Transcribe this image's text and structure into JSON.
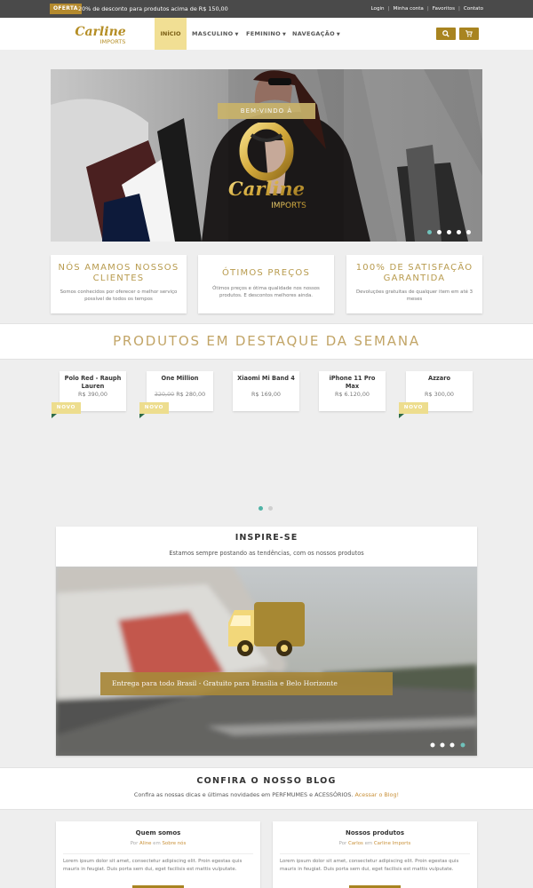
{
  "topbar": {
    "badge": "OFERTA",
    "promo": "20% de desconto para produtos acima de R$ 150,00",
    "links": [
      "Login",
      "Minha conta",
      "Favoritos",
      "Contato"
    ]
  },
  "brand": {
    "name": "Carline",
    "sub": "IMPORTS"
  },
  "nav": {
    "items": [
      "INÍCIO",
      "MASCULINO",
      "FEMININO",
      "NAVEGAÇÃO"
    ],
    "search_icon": "search-icon",
    "cart_icon": "cart-icon"
  },
  "hero": {
    "welcome": "BEM-VINDO À",
    "dots": 5,
    "active_dot": 0
  },
  "features": [
    {
      "title": "NÓS AMAMOS NOSSOS CLIENTES",
      "text": "Somos conhecidos por oferecer o melhor serviço possível de todos os tempos"
    },
    {
      "title": "ÓTIMOS PREÇOS",
      "text": "Ótimos preços e ótima qualidade nos nossos produtos. E descontos melhores ainda."
    },
    {
      "title": "100% DE SATISFAÇÃO GARANTIDA",
      "text": "Devoluções gratuitas de qualquer item em até 3 meses"
    }
  ],
  "products_section": {
    "title": "PRODUTOS EM DESTAQUE DA SEMANA"
  },
  "products": [
    {
      "name": "Polo Red - Rauph Lauren",
      "old_price": "",
      "price": "R$ 390,00",
      "badge": "NOVO"
    },
    {
      "name": "One Million",
      "old_price": "320,00",
      "price": "R$ 280,00",
      "badge": "NOVO"
    },
    {
      "name": "Xiaomi Mi Band 4",
      "old_price": "",
      "price": "R$ 169,00",
      "badge": ""
    },
    {
      "name": "iPhone 11 Pro Max",
      "old_price": "",
      "price": "R$ 6.120,00",
      "badge": ""
    },
    {
      "name": "Azzaro",
      "old_price": "",
      "price": "R$ 300,00",
      "badge": "NOVO"
    }
  ],
  "inspire": {
    "title": "INSPIRE-SE",
    "subtitle": "Estamos sempre postando as tendências, com os nossos produtos",
    "caption": "Entrega para todo Brasil - Gratuito para Brasília e Belo Horizonte"
  },
  "blog": {
    "title": "CONFIRA O NOSSO BLOG",
    "subtitle": "Confira as nossas dicas e últimas novidades em PERFMUMES e ACESSÓRIOS.",
    "link": "Acessar o Blog!",
    "posts": [
      {
        "title": "Quem somos",
        "by": "Por",
        "author": "Aline",
        "in": "em",
        "category": "Sobre nós",
        "excerpt": "Lorem ipsum dolor sit amet, consectetur adipiscing elit. Proin egestas quis mauris in feugiat. Duis porta sem dui, eget facilisis est mattis vulputate."
      },
      {
        "title": "Nossos produtos",
        "by": "Por",
        "author": "Carlos",
        "in": "em",
        "category": "Carline Imports",
        "excerpt": "Lorem ipsum dolor sit amet, consectetur adipiscing elit. Proin egestas quis mauris in feugiat. Duis porta sem dui, eget facilisis est mattis vulputate."
      }
    ]
  },
  "colors": {
    "gold": "#a88420",
    "dark_bar": "#4a4a4a",
    "accent_nav": "#f1df94",
    "teal_dot": "#4fb3a6"
  }
}
